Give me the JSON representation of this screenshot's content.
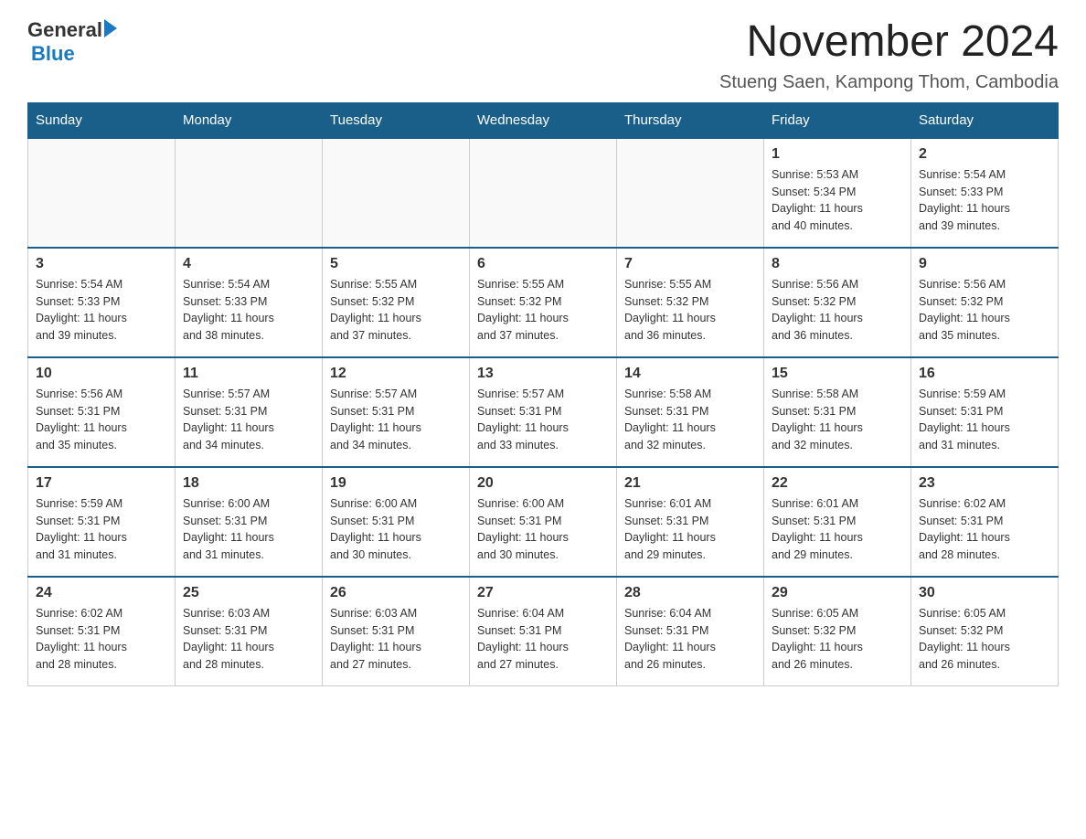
{
  "header": {
    "logo": {
      "text_general": "General",
      "text_blue": "Blue",
      "arrow": true
    },
    "title": "November 2024",
    "subtitle": "Stueng Saen, Kampong Thom, Cambodia"
  },
  "calendar": {
    "days_of_week": [
      "Sunday",
      "Monday",
      "Tuesday",
      "Wednesday",
      "Thursday",
      "Friday",
      "Saturday"
    ],
    "weeks": [
      {
        "days": [
          {
            "number": "",
            "info": ""
          },
          {
            "number": "",
            "info": ""
          },
          {
            "number": "",
            "info": ""
          },
          {
            "number": "",
            "info": ""
          },
          {
            "number": "",
            "info": ""
          },
          {
            "number": "1",
            "info": "Sunrise: 5:53 AM\nSunset: 5:34 PM\nDaylight: 11 hours\nand 40 minutes."
          },
          {
            "number": "2",
            "info": "Sunrise: 5:54 AM\nSunset: 5:33 PM\nDaylight: 11 hours\nand 39 minutes."
          }
        ]
      },
      {
        "days": [
          {
            "number": "3",
            "info": "Sunrise: 5:54 AM\nSunset: 5:33 PM\nDaylight: 11 hours\nand 39 minutes."
          },
          {
            "number": "4",
            "info": "Sunrise: 5:54 AM\nSunset: 5:33 PM\nDaylight: 11 hours\nand 38 minutes."
          },
          {
            "number": "5",
            "info": "Sunrise: 5:55 AM\nSunset: 5:32 PM\nDaylight: 11 hours\nand 37 minutes."
          },
          {
            "number": "6",
            "info": "Sunrise: 5:55 AM\nSunset: 5:32 PM\nDaylight: 11 hours\nand 37 minutes."
          },
          {
            "number": "7",
            "info": "Sunrise: 5:55 AM\nSunset: 5:32 PM\nDaylight: 11 hours\nand 36 minutes."
          },
          {
            "number": "8",
            "info": "Sunrise: 5:56 AM\nSunset: 5:32 PM\nDaylight: 11 hours\nand 36 minutes."
          },
          {
            "number": "9",
            "info": "Sunrise: 5:56 AM\nSunset: 5:32 PM\nDaylight: 11 hours\nand 35 minutes."
          }
        ]
      },
      {
        "days": [
          {
            "number": "10",
            "info": "Sunrise: 5:56 AM\nSunset: 5:31 PM\nDaylight: 11 hours\nand 35 minutes."
          },
          {
            "number": "11",
            "info": "Sunrise: 5:57 AM\nSunset: 5:31 PM\nDaylight: 11 hours\nand 34 minutes."
          },
          {
            "number": "12",
            "info": "Sunrise: 5:57 AM\nSunset: 5:31 PM\nDaylight: 11 hours\nand 34 minutes."
          },
          {
            "number": "13",
            "info": "Sunrise: 5:57 AM\nSunset: 5:31 PM\nDaylight: 11 hours\nand 33 minutes."
          },
          {
            "number": "14",
            "info": "Sunrise: 5:58 AM\nSunset: 5:31 PM\nDaylight: 11 hours\nand 32 minutes."
          },
          {
            "number": "15",
            "info": "Sunrise: 5:58 AM\nSunset: 5:31 PM\nDaylight: 11 hours\nand 32 minutes."
          },
          {
            "number": "16",
            "info": "Sunrise: 5:59 AM\nSunset: 5:31 PM\nDaylight: 11 hours\nand 31 minutes."
          }
        ]
      },
      {
        "days": [
          {
            "number": "17",
            "info": "Sunrise: 5:59 AM\nSunset: 5:31 PM\nDaylight: 11 hours\nand 31 minutes."
          },
          {
            "number": "18",
            "info": "Sunrise: 6:00 AM\nSunset: 5:31 PM\nDaylight: 11 hours\nand 31 minutes."
          },
          {
            "number": "19",
            "info": "Sunrise: 6:00 AM\nSunset: 5:31 PM\nDaylight: 11 hours\nand 30 minutes."
          },
          {
            "number": "20",
            "info": "Sunrise: 6:00 AM\nSunset: 5:31 PM\nDaylight: 11 hours\nand 30 minutes."
          },
          {
            "number": "21",
            "info": "Sunrise: 6:01 AM\nSunset: 5:31 PM\nDaylight: 11 hours\nand 29 minutes."
          },
          {
            "number": "22",
            "info": "Sunrise: 6:01 AM\nSunset: 5:31 PM\nDaylight: 11 hours\nand 29 minutes."
          },
          {
            "number": "23",
            "info": "Sunrise: 6:02 AM\nSunset: 5:31 PM\nDaylight: 11 hours\nand 28 minutes."
          }
        ]
      },
      {
        "days": [
          {
            "number": "24",
            "info": "Sunrise: 6:02 AM\nSunset: 5:31 PM\nDaylight: 11 hours\nand 28 minutes."
          },
          {
            "number": "25",
            "info": "Sunrise: 6:03 AM\nSunset: 5:31 PM\nDaylight: 11 hours\nand 28 minutes."
          },
          {
            "number": "26",
            "info": "Sunrise: 6:03 AM\nSunset: 5:31 PM\nDaylight: 11 hours\nand 27 minutes."
          },
          {
            "number": "27",
            "info": "Sunrise: 6:04 AM\nSunset: 5:31 PM\nDaylight: 11 hours\nand 27 minutes."
          },
          {
            "number": "28",
            "info": "Sunrise: 6:04 AM\nSunset: 5:31 PM\nDaylight: 11 hours\nand 26 minutes."
          },
          {
            "number": "29",
            "info": "Sunrise: 6:05 AM\nSunset: 5:32 PM\nDaylight: 11 hours\nand 26 minutes."
          },
          {
            "number": "30",
            "info": "Sunrise: 6:05 AM\nSunset: 5:32 PM\nDaylight: 11 hours\nand 26 minutes."
          }
        ]
      }
    ]
  }
}
